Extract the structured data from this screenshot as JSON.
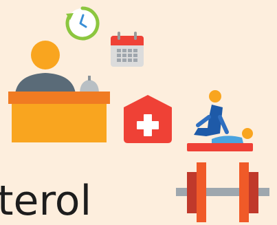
{
  "caption": {
    "text": "terol"
  },
  "icons": [
    {
      "name": "clock-refresh-icon"
    },
    {
      "name": "calendar-icon"
    },
    {
      "name": "reception-desk-icon"
    },
    {
      "name": "medical-cross-icon"
    },
    {
      "name": "physiotherapy-massage-icon"
    },
    {
      "name": "dumbbell-icon"
    }
  ],
  "colors": {
    "background": "#fdeedd",
    "desk": "#f9a51f",
    "desk_top": "#f07b22",
    "medical_red": "#ef4136",
    "clock_green": "#8cc63f",
    "therapist_blue": "#1e5aa8"
  }
}
